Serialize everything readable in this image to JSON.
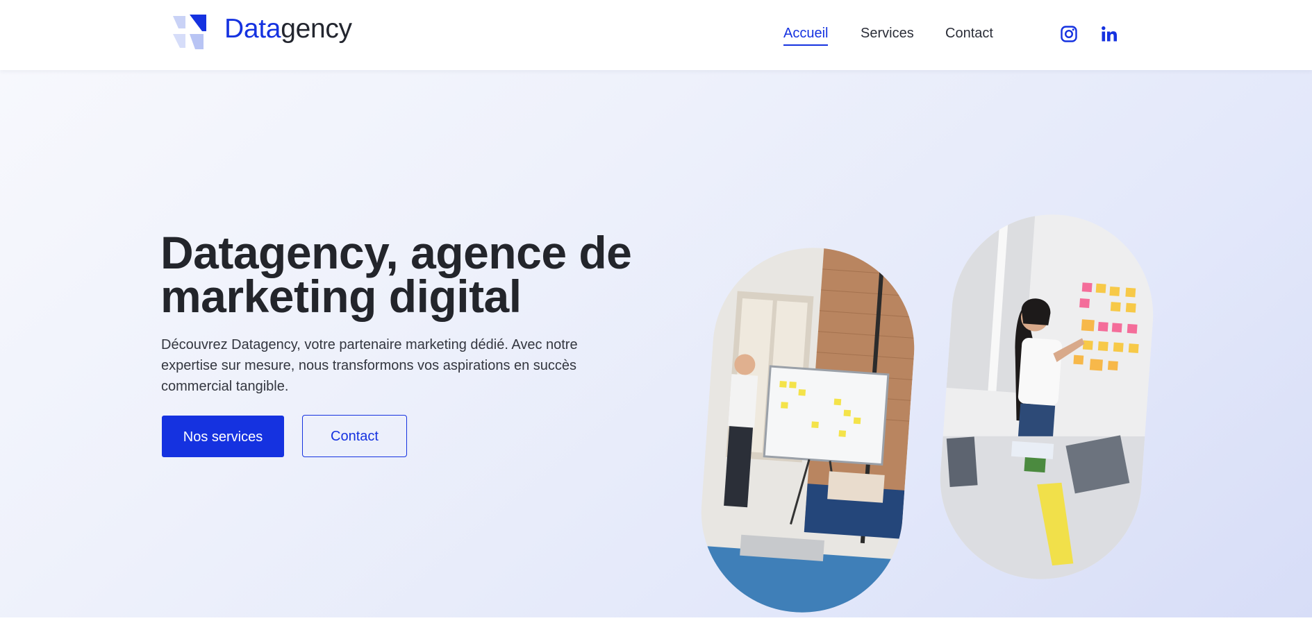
{
  "header": {
    "brand_part1": "Data",
    "brand_part2": "gency",
    "logo_icon": "datagency-logo-icon",
    "nav": [
      {
        "label": "Accueil",
        "active": true
      },
      {
        "label": "Services",
        "active": false
      },
      {
        "label": "Contact",
        "active": false
      }
    ],
    "social": [
      {
        "icon": "instagram-icon"
      },
      {
        "icon": "linkedin-icon"
      }
    ]
  },
  "hero": {
    "title_line1": "Datagency, agence de",
    "title_line2": "marketing digital",
    "description_line1": "Découvrez Datagency, votre partenaire marketing dédié. Avec notre",
    "description_line2": "expertise sur mesure, nous transformons vos aspirations en succès",
    "description_line3": "commercial tangible.",
    "primary_button": "Nos services",
    "secondary_button": "Contact",
    "images": [
      {
        "name": "team-whiteboard-photo"
      },
      {
        "name": "woman-sticky-notes-photo"
      }
    ]
  },
  "colors": {
    "accent": "#1532e0",
    "text": "#23252b",
    "hero_gradient_start": "#f7f8fd",
    "hero_gradient_end": "#d7ddf7"
  }
}
